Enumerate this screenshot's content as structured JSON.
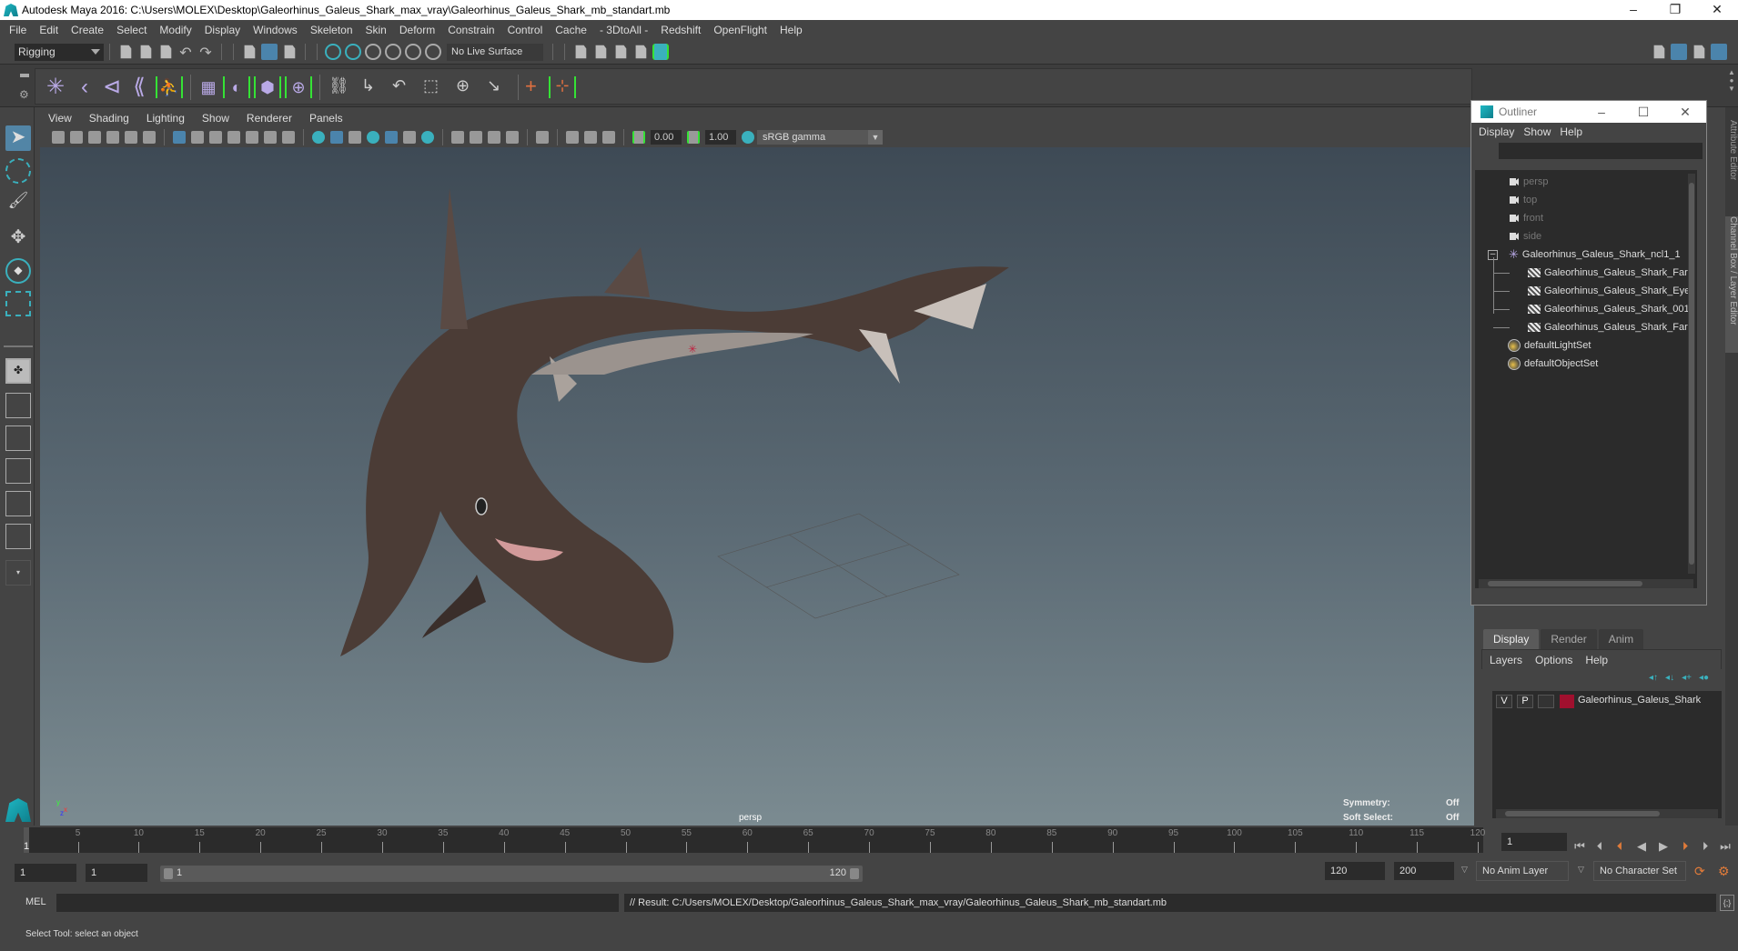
{
  "window": {
    "title": "Autodesk Maya 2016: C:\\Users\\MOLEX\\Desktop\\Galeorhinus_Galeus_Shark_max_vray\\Galeorhinus_Galeus_Shark_mb_standart.mb",
    "controls": {
      "minimize": "–",
      "restore": "❐",
      "close": "✕"
    }
  },
  "menubar": [
    "File",
    "Edit",
    "Create",
    "Select",
    "Modify",
    "Display",
    "Windows",
    "Skeleton",
    "Skin",
    "Deform",
    "Constrain",
    "Control",
    "Cache",
    "- 3DtoAll -",
    "Redshift",
    "OpenFlight",
    "Help"
  ],
  "status_line": {
    "mode": "Rigging",
    "live_surface": "No Live Surface"
  },
  "shelf": {
    "icons": [
      "joint-tool-icon",
      "ik-handle-icon",
      "ik-spline-icon",
      "insert-joint-icon",
      "quick-rig-icon",
      "paint-weights-icon",
      "bind-skin-icon",
      "lattice-icon",
      "cluster-icon",
      "parent-constraint-icon",
      "point-constraint-icon",
      "orient-constraint-icon",
      "scale-constraint-icon",
      "aim-constraint-icon",
      "pole-vector-icon",
      "locator-icon",
      "parent-icon"
    ]
  },
  "panel": {
    "menus": [
      "View",
      "Shading",
      "Lighting",
      "Show",
      "Renderer",
      "Panels"
    ],
    "exposure": "0.00",
    "gamma": "1.00",
    "color_space": "sRGB gamma",
    "camera_label": "persp",
    "hud": {
      "symmetry_label": "Symmetry:",
      "symmetry_value": "Off",
      "soft_select_label": "Soft Select:",
      "soft_select_value": "Off"
    },
    "axis": {
      "x": "x",
      "y": "y",
      "z": "z"
    }
  },
  "outliner": {
    "title": "Outliner",
    "menus": [
      "Display",
      "Show",
      "Help"
    ],
    "items": [
      {
        "label": "persp",
        "type": "camera",
        "depth": 0
      },
      {
        "label": "top",
        "type": "camera",
        "depth": 0
      },
      {
        "label": "front",
        "type": "camera",
        "depth": 0
      },
      {
        "label": "side",
        "type": "camera",
        "depth": 0
      },
      {
        "label": "Galeorhinus_Galeus_Shark_ncl1_1",
        "type": "group",
        "depth": 0,
        "expanded": true
      },
      {
        "label": "Galeorhinus_Galeus_Shark_Far",
        "type": "mesh",
        "depth": 1
      },
      {
        "label": "Galeorhinus_Galeus_Shark_Eye",
        "type": "mesh",
        "depth": 1
      },
      {
        "label": "Galeorhinus_Galeus_Shark_001",
        "type": "mesh",
        "depth": 1
      },
      {
        "label": "Galeorhinus_Galeus_Shark_Far",
        "type": "mesh",
        "depth": 1
      },
      {
        "label": "defaultLightSet",
        "type": "set",
        "depth": 0
      },
      {
        "label": "defaultObjectSet",
        "type": "set",
        "depth": 0
      }
    ]
  },
  "side_tabs": [
    "Attribute Editor",
    "Channel Box / Layer Editor"
  ],
  "layer_editor": {
    "tabs": [
      "Display",
      "Render",
      "Anim"
    ],
    "active_tab": "Display",
    "menus": [
      "Layers",
      "Options",
      "Help"
    ],
    "layers": [
      {
        "visible": "V",
        "playback": "P",
        "name": "Galeorhinus_Galeus_Shark",
        "color": "#a0102e"
      }
    ]
  },
  "timeline": {
    "start": 1,
    "end": 120,
    "ticks": [
      5,
      10,
      15,
      20,
      25,
      30,
      35,
      40,
      45,
      50,
      55,
      60,
      65,
      70,
      75,
      80,
      85,
      90,
      95,
      100,
      105,
      110,
      115,
      120
    ],
    "current_frame_label": "1",
    "current_frame_field": "1",
    "playback_buttons": [
      "go-to-start",
      "step-back-key",
      "step-back-frame",
      "play-backwards",
      "play-forwards",
      "step-forward-frame",
      "step-forward-key",
      "go-to-end"
    ]
  },
  "range": {
    "start_time": "1",
    "playback_start": "1",
    "slider_start": "1",
    "slider_end": "120",
    "playback_end": "120",
    "end_time": "200",
    "anim_layer": "No Anim Layer",
    "character_set": "No Character Set"
  },
  "command_line": {
    "language": "MEL",
    "input": "",
    "result": "// Result: C:/Users/MOLEX/Desktop/Galeorhinus_Galeus_Shark_max_vray/Galeorhinus_Galeus_Shark_mb_standart.mb"
  },
  "help_line": "Select Tool: select an object",
  "colors": {
    "accent": "#4b84ac",
    "highlight_green": "#35e235",
    "maya_teal": "#1fb8c4",
    "layer_red": "#a0102e"
  }
}
